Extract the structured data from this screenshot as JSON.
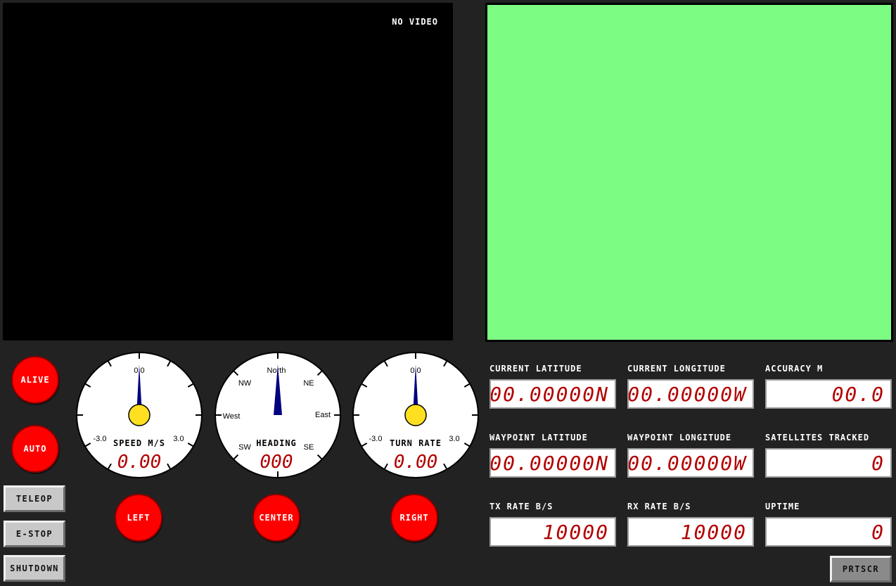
{
  "video": {
    "status_text": "NO VIDEO"
  },
  "indicators": {
    "alive": "ALIVE",
    "auto": "AUTO",
    "left": "LEFT",
    "center": "CENTER",
    "right": "RIGHT",
    "color_on": "#ff0000"
  },
  "buttons": {
    "teleop": "TELEOP",
    "estop": "E-STOP",
    "shutdown": "SHUTDOWN",
    "prtscr": "PRTSCR"
  },
  "gauges": {
    "speed": {
      "label": "SPEED M/S",
      "value_display": "0.00",
      "top_label": "0.0",
      "min_label": "-3.0",
      "max_label": "3.0",
      "value": 0.0,
      "range": [
        -3.0,
        3.0
      ]
    },
    "heading": {
      "label": "HEADING",
      "value_display": "000",
      "value": 0,
      "compass": {
        "n": "North",
        "ne": "NE",
        "e": "East",
        "se": "SE",
        "sw": "SW",
        "w": "West",
        "nw": "NW"
      }
    },
    "turn_rate": {
      "label": "TURN RATE",
      "value_display": "0.00",
      "top_label": "0.0",
      "min_label": "-3.0",
      "max_label": "3.0",
      "value": 0.0,
      "range": [
        -3.0,
        3.0
      ]
    }
  },
  "telemetry": {
    "current_latitude": {
      "label": "CURRENT LATITUDE",
      "value": "00.00000N"
    },
    "current_longitude": {
      "label": "CURRENT LONGITUDE",
      "value": "00.00000W"
    },
    "accuracy": {
      "label": "ACCURACY M",
      "value": "00.0"
    },
    "waypoint_latitude": {
      "label": "WAYPOINT LATITUDE",
      "value": "00.00000N"
    },
    "waypoint_longitude": {
      "label": "WAYPOINT LONGITUDE",
      "value": "00.00000W"
    },
    "satellites_tracked": {
      "label": "SATELLITES TRACKED",
      "value": "0"
    },
    "tx_rate": {
      "label": "TX RATE B/S",
      "value": "10000"
    },
    "rx_rate": {
      "label": "RX RATE B/S",
      "value": "10000"
    },
    "uptime": {
      "label": "UPTIME",
      "value": "0"
    }
  },
  "colors": {
    "map_background": "#7cfc82",
    "needle": "#000080",
    "hub": "#ffe020",
    "digit": "#b20000"
  }
}
